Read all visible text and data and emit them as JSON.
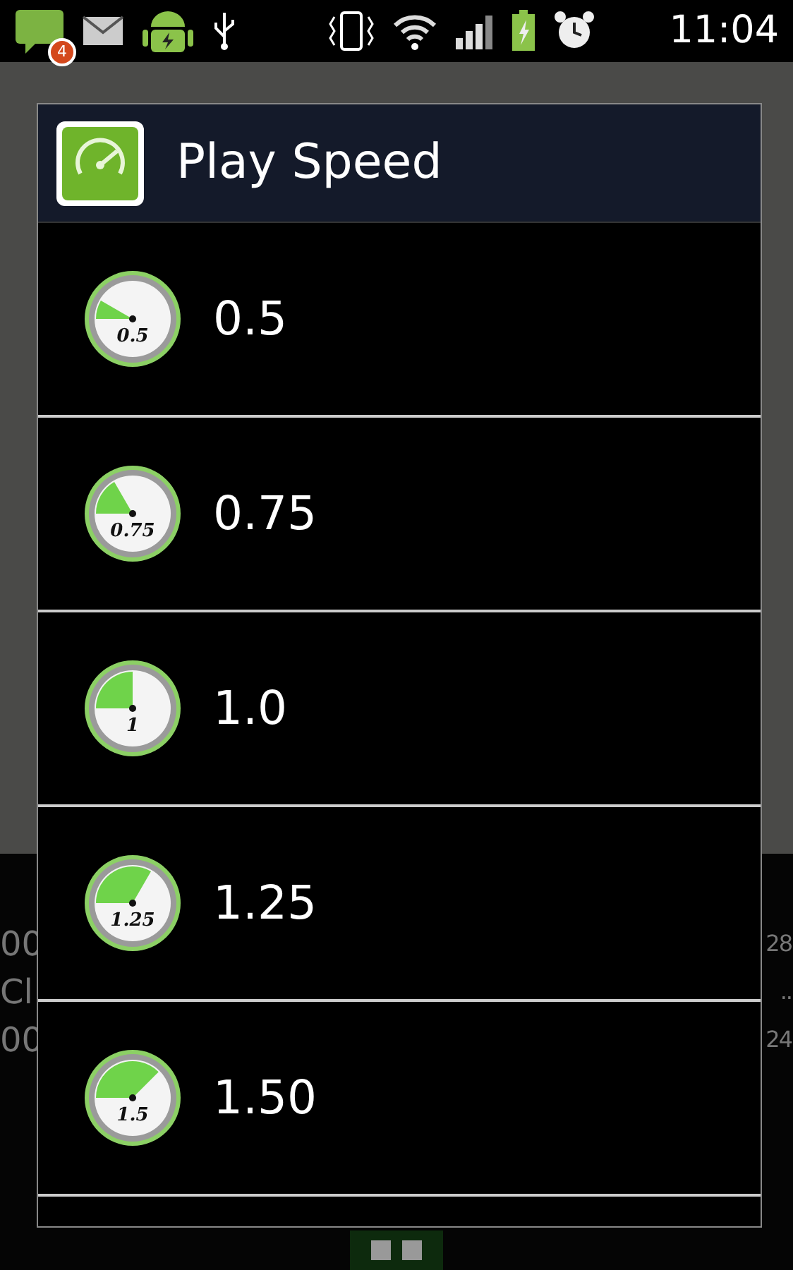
{
  "status_bar": {
    "notification_count": "4",
    "time": "11:04"
  },
  "background": {
    "left_texts": [
      "00",
      "Cl",
      "00"
    ],
    "right_texts": [
      "28",
      "..",
      "24"
    ]
  },
  "dialog": {
    "title": "Play Speed",
    "options": [
      {
        "label": "0.5",
        "gauge_label": "0.5"
      },
      {
        "label": "0.75",
        "gauge_label": "0.75"
      },
      {
        "label": "1.0",
        "gauge_label": "1"
      },
      {
        "label": "1.25",
        "gauge_label": "1.25"
      },
      {
        "label": "1.50",
        "gauge_label": "1.5"
      }
    ]
  }
}
